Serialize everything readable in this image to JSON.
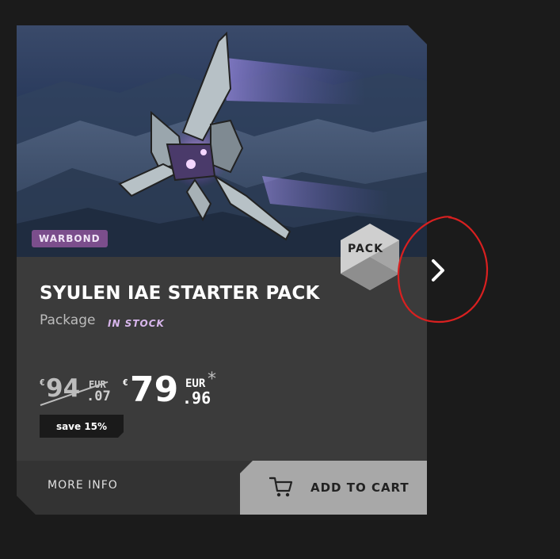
{
  "product": {
    "badge": "WARBOND",
    "title": "SYULEN IAE STARTER PACK",
    "type": "Package",
    "stock_status": "IN STOCK",
    "pack_label": "PACK"
  },
  "price": {
    "old_currency_symbol": "€",
    "old_integer": "94",
    "old_unit": "EUR",
    "old_decimal": ".07",
    "new_currency_symbol": "€",
    "new_integer": "79",
    "new_unit": "EUR",
    "new_decimal": ".96",
    "asterisk": "*",
    "save_label": "save 15%"
  },
  "footer": {
    "more_info": "MORE INFO",
    "add_to_cart": "ADD TO CART"
  },
  "icons": {
    "cart": "shopping-cart-icon",
    "next": "chevron-right-icon",
    "pack": "pack-hexagon-icon"
  },
  "colors": {
    "page_bg": "#1b1b1b",
    "card_bg": "#3b3b3b",
    "badge": "#7b4e8c",
    "stock": "#d8b6ec",
    "cart_button": "#a8a8a8",
    "annotation": "#d92020"
  }
}
